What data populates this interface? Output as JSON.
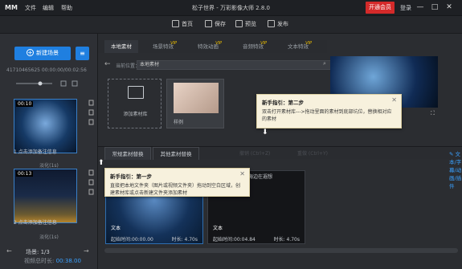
{
  "app": {
    "logo": "MM",
    "menu": [
      "文件",
      "编辑",
      "帮助"
    ],
    "title": "松子世界 - 万彩影像大师 2.8.0",
    "vip_label": "开通会员",
    "login_label": "登录",
    "window_controls": [
      "—",
      "□",
      "✕"
    ]
  },
  "toolbar": {
    "items": [
      {
        "label": "首页",
        "icon": "home-icon"
      },
      {
        "label": "保存",
        "icon": "save-icon"
      },
      {
        "label": "预览",
        "icon": "preview-icon"
      },
      {
        "label": "发布",
        "icon": "publish-icon"
      }
    ]
  },
  "sidebar": {
    "new_scene_label": "新建场景",
    "scene_id": "41710465625   00:00:00/00:02:56",
    "scenes": [
      {
        "time": "00:10",
        "caption": "1 点击添加备注信息",
        "sub": "淡化(1s)"
      },
      {
        "time": "00:13",
        "caption": "2 点击添加备注信息",
        "sub": "淡化(1s)"
      }
    ],
    "scene_count_label": "场景: 1/3",
    "video_len_label": "视频总时长:",
    "video_len_value": "00:38.00"
  },
  "tabs": [
    {
      "label": "本地素材",
      "vip": false
    },
    {
      "label": "场景特效",
      "vip": true
    },
    {
      "label": "特效动画",
      "vip": true
    },
    {
      "label": "音频特效",
      "vip": true
    },
    {
      "label": "文本特效",
      "vip": true
    }
  ],
  "vip_mark": "VIP",
  "location": {
    "label": "当前位置：",
    "value": "本地素材"
  },
  "library": {
    "add_folder_label": "添加素材库",
    "sample_label": "样例"
  },
  "bottom": {
    "tabs": [
      "常规素材替换",
      "其他素材替换"
    ],
    "undo_label": "撤销 (Ctrl+Z)",
    "redo_label": "重做 (Ctrl+Y)",
    "text_fx_label": "文本/字幕/动画/插件"
  },
  "timeline": [
    {
      "text_label": "文本",
      "start": "起始时间:00:00.00",
      "duration": "时长: 4.70s"
    },
    {
      "text_label": "文本",
      "start": "起始时间:00:04.84",
      "duration": "时长: 4.70s"
    }
  ],
  "tip_step2": {
    "title": "新手指引：第二步",
    "body": "双击打开素材库--->拖动里面的素材到底部坑位，替换相对应的素材"
  },
  "tip_step1": {
    "title": "新手指引：第一步",
    "body": "直接把本地文件夹（图片或视频文件夹）拖动到空白区域，创建素材库或点击新建文件夹添加素材"
  },
  "partial_label": "海边在遐想"
}
